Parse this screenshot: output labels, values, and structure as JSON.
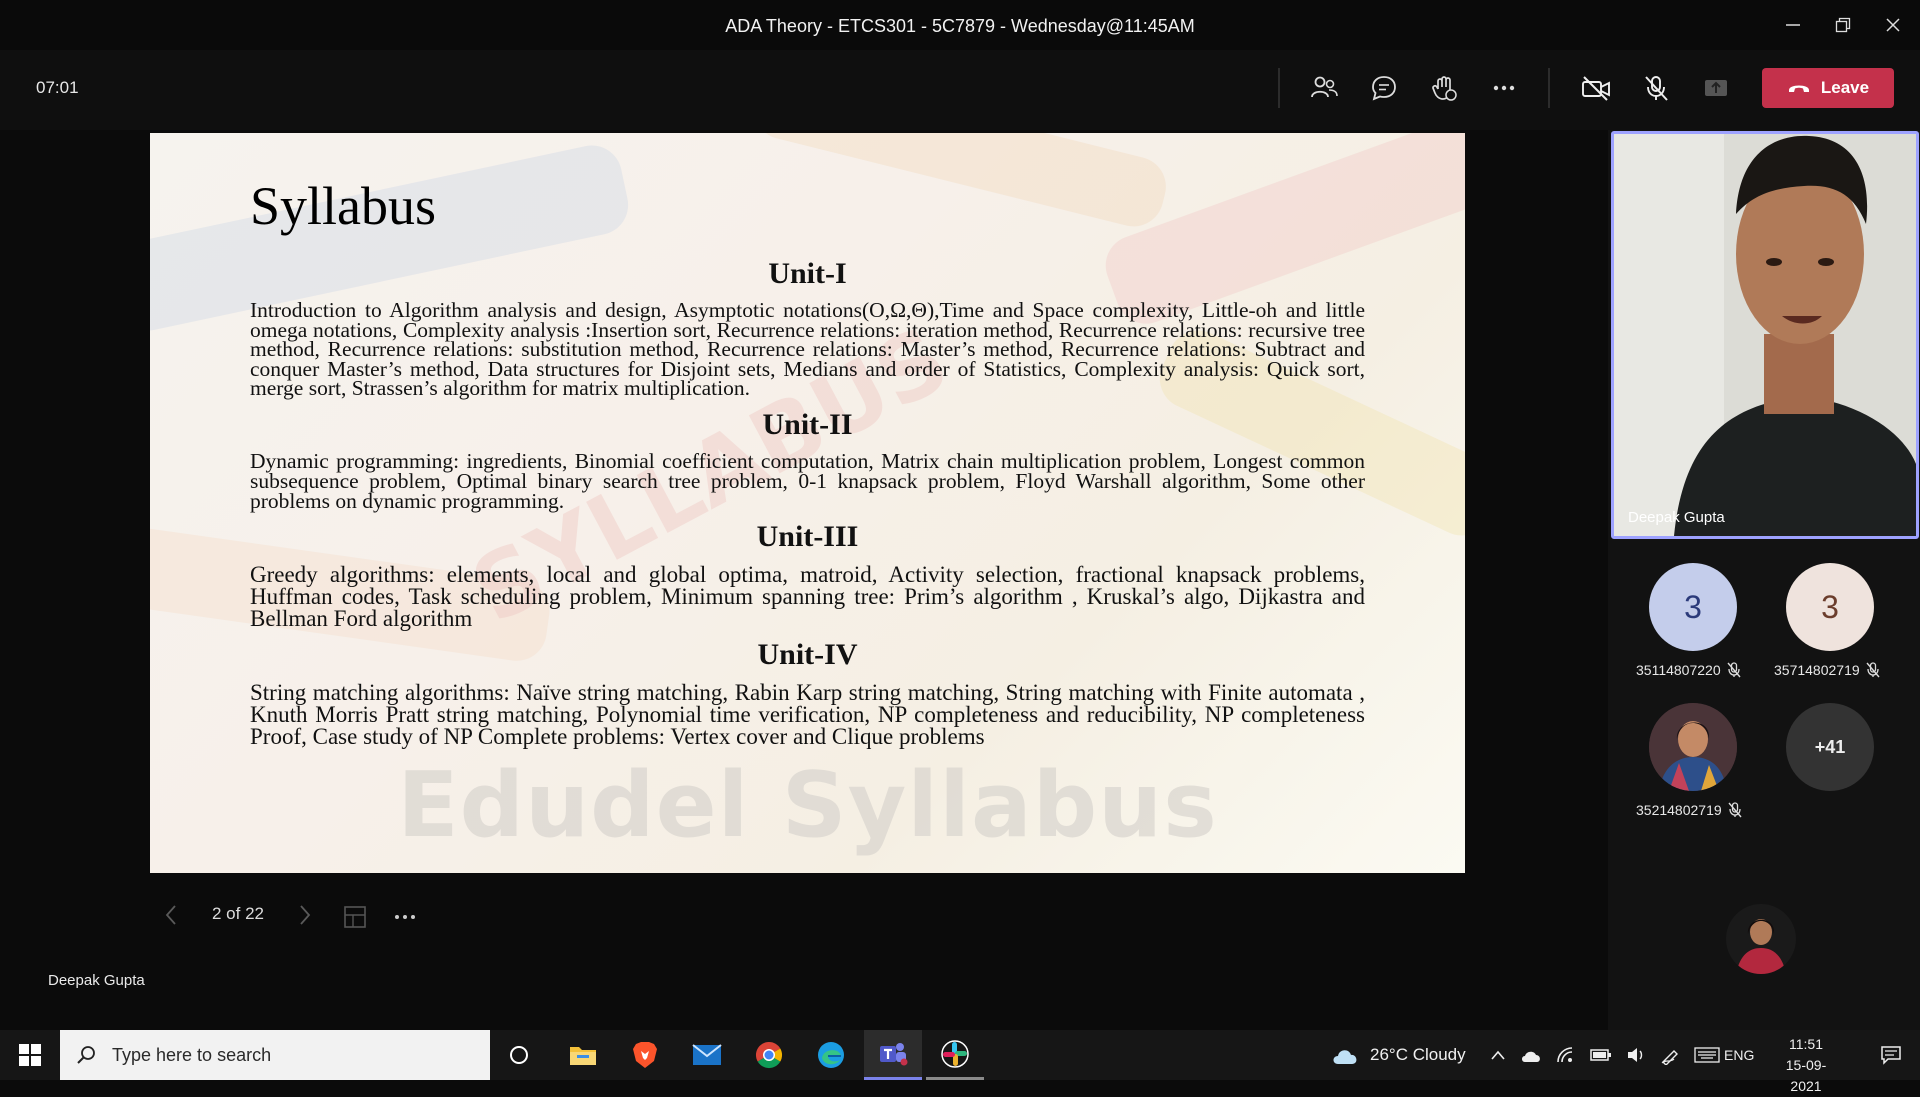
{
  "window": {
    "title": "ADA Theory - ETCS301 - 5C7879 - Wednesday@11:45AM"
  },
  "meeting": {
    "timer": "07:01",
    "leave_label": "Leave"
  },
  "slide": {
    "title": "Syllabus",
    "watermark": "Edudel Syllabus",
    "units": [
      {
        "heading": "Unit-I",
        "body": "Introduction to Algorithm analysis and design, Asymptotic notations(O,Ω,Θ),Time and Space complexity, Little-oh and little omega notations, Complexity analysis :Insertion sort, Recurrence relations: iteration method, Recurrence relations: recursive tree method, Recurrence relations: substitution method, Recurrence relations: Master’s method, Recurrence relations: Subtract and conquer Master’s  method, Data structures for Disjoint sets, Medians and order of Statistics, Complexity analysis: Quick sort, merge sort, Strassen’s algorithm for matrix multiplication."
      },
      {
        "heading": "Unit-II",
        "body": "Dynamic programming: ingredients, Binomial coefficient computation, Matrix chain multiplication problem, Longest common subsequence problem, Optimal binary search tree problem, 0-1 knapsack problem, Floyd Warshall algorithm, Some other problems on dynamic programming."
      },
      {
        "heading": "Unit-III",
        "body": "Greedy algorithms: elements, local and global optima, matroid, Activity selection, fractional knapsack problems, Huffman codes, Task scheduling problem, Minimum spanning tree: Prim’s algorithm , Kruskal’s algo, Dijkastra and Bellman Ford algorithm"
      },
      {
        "heading": "Unit-IV",
        "body": "String matching algorithms: Naïve string matching, Rabin Karp string matching, String matching with Finite automata , Knuth Morris Pratt string matching, Polynomial time verification, NP completeness and reducibility, NP completeness Proof, Case study of NP Complete problems: Vertex cover and Clique problems"
      }
    ]
  },
  "pager": {
    "count": "2 of 22"
  },
  "presenter": {
    "name": "Deepak Gupta"
  },
  "participants": {
    "video_name": "Deepak Gupta",
    "list": [
      {
        "initial": "3",
        "name": "35114807220",
        "avatar_bg": "#c4cdeb",
        "avatar_fg": "#2b3a7a"
      },
      {
        "initial": "3",
        "name": "35714802719",
        "avatar_bg": "#efe3dd",
        "avatar_fg": "#6b3d2c"
      },
      {
        "initial": "",
        "name": "35214802719",
        "avatar_bg": "#6a3a4a",
        "avatar_fg": "#ffffff"
      }
    ],
    "overflow": "+41"
  },
  "taskbar": {
    "search_placeholder": "Type here to search",
    "weather": "26°C  Cloudy",
    "language": "ENG",
    "time": "11:51",
    "date": "15-09-2021"
  },
  "colors": {
    "leave": "#c4314b",
    "active_speaker_border": "#9ea2ff",
    "teams_accent": "#6264a7"
  }
}
